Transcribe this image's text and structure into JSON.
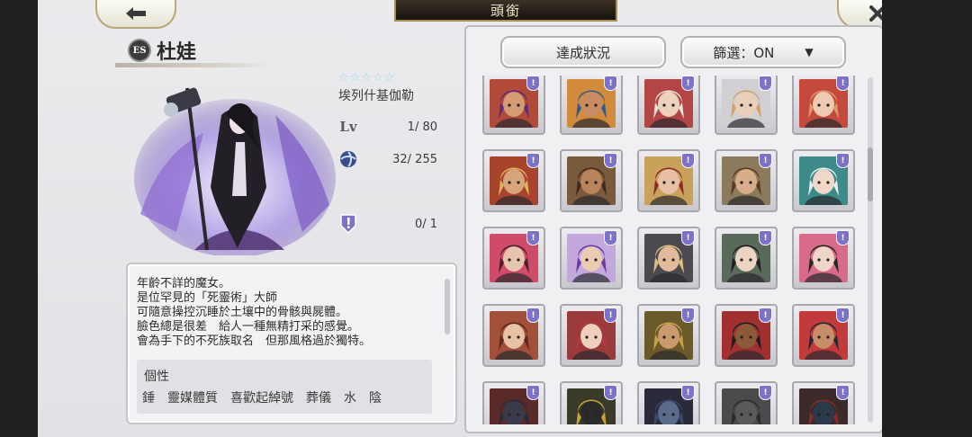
{
  "header": {
    "title": "頭銜",
    "back_icon": "left-arrow-icon",
    "close_icon": "close-icon"
  },
  "character": {
    "badge": "ES",
    "name": "杜娃",
    "stars": 5,
    "rarity_label": "埃列什基伽勒",
    "stats": {
      "level": "1/ 80",
      "sphere": "32/ 255",
      "special": "0/ 1"
    },
    "description": [
      "年齡不詳的魔女。",
      "是位罕見的「死靈術」大師",
      "可隨意操控沉睡於土壤中的骨骸與屍體。",
      "臉色總是很差　給人一種無精打采的感覺。",
      "會為手下的不死族取名　但那風格過於獨特。"
    ],
    "traits_title": "個性",
    "traits": [
      "錘",
      "靈媒體質",
      "喜歡起綽號",
      "葬儀",
      "水",
      "陰"
    ]
  },
  "panel": {
    "status_button": "達成狀況",
    "filter_button": "篩選：ON",
    "badge_glyph": "!"
  },
  "tiles": [
    {
      "hair": "#5b2a7a",
      "skin": "#d59b73",
      "bg": "#b24a3a"
    },
    {
      "hair": "#2f5a8c",
      "skin": "#c98b62",
      "bg": "#d28a3c"
    },
    {
      "hair": "#e7e4dc",
      "skin": "#edd2bd",
      "bg": "#b44545"
    },
    {
      "hair": "#d4a06a",
      "skin": "#eacfb8",
      "bg": "#d0d0d4"
    },
    {
      "hair": "#e09a6a",
      "skin": "#eecbb0",
      "bg": "#c34a3c"
    },
    {
      "hair": "#e0b25a",
      "skin": "#d8a47c",
      "bg": "#a8442c"
    },
    {
      "hair": "#3d2a1e",
      "skin": "#b9835c",
      "bg": "#7a5a3c"
    },
    {
      "hair": "#8a2a2a",
      "skin": "#e7c0a6",
      "bg": "#c8a25a"
    },
    {
      "hair": "#5a3a22",
      "skin": "#d9ad8a",
      "bg": "#8c7a5c"
    },
    {
      "hair": "#e8eef0",
      "skin": "#f0d8c8",
      "bg": "#3c8a8a"
    },
    {
      "hair": "#4a1e2a",
      "skin": "#e6c4ae",
      "bg": "#d04a6a"
    },
    {
      "hair": "#6a3aa2",
      "skin": "#ebcbb2",
      "bg": "#c2a8dc"
    },
    {
      "hair": "#dcc07a",
      "skin": "#e2bb9c",
      "bg": "#4a4a50"
    },
    {
      "hair": "#1e1e24",
      "skin": "#ecd2c0",
      "bg": "#5a6a5a"
    },
    {
      "hair": "#1e2a1e",
      "skin": "#f0d6c8",
      "bg": "#d86a8a"
    },
    {
      "hair": "#5a2a1e",
      "skin": "#e8c2a4",
      "bg": "#a2503a"
    },
    {
      "hair": "#b23a42",
      "skin": "#efcfbe",
      "bg": "#9a3a3a"
    },
    {
      "hair": "#caa24a",
      "skin": "#c99a6c",
      "bg": "#6a5a2a"
    },
    {
      "hair": "#1e1e1e",
      "skin": "#8a5a3a",
      "bg": "#a23030"
    },
    {
      "hair": "#1e2a3a",
      "skin": "#c88e6a",
      "bg": "#c23a3a"
    },
    {
      "hair": "#2a2a3a",
      "skin": "#3a3a4a",
      "bg": "#5a2a2a"
    },
    {
      "hair": "#c8a23a",
      "skin": "#2a2a2a",
      "bg": "#3a3a2a"
    },
    {
      "hair": "#3a4a6a",
      "skin": "#5a6a8a",
      "bg": "#2a2a3a"
    },
    {
      "hair": "#2a2a2a",
      "skin": "#5a5a5a",
      "bg": "#4a4a4a"
    },
    {
      "hair": "#8a2a2a",
      "skin": "#2a3a4a",
      "bg": "#3a2a2a"
    }
  ]
}
